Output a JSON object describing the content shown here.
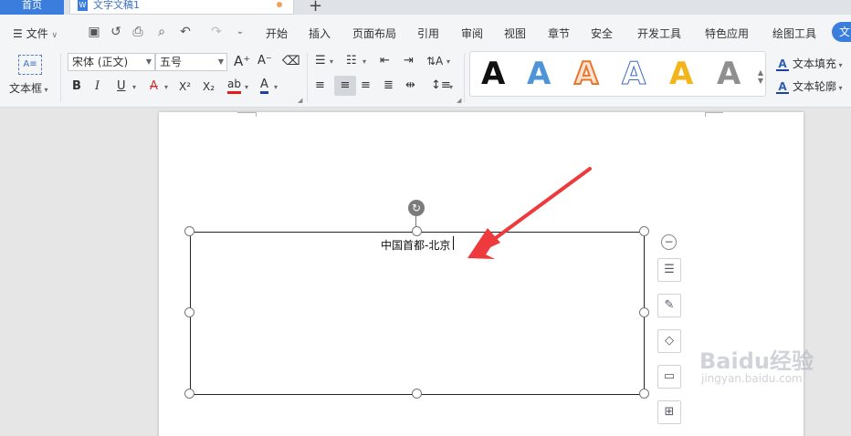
{
  "titlebar": {
    "home_tab": "首页",
    "doc_tab": "文字文稿1",
    "doc_icon": "W",
    "new_tab": "+"
  },
  "menubar": {
    "file_menu": "文件",
    "tabs": [
      "开始",
      "插入",
      "页面布局",
      "引用",
      "审阅",
      "视图",
      "章节",
      "安全",
      "开发工具",
      "特色应用",
      "绘图工具",
      "文"
    ]
  },
  "ribbon": {
    "textbox_label": "文本框",
    "font_name": "宋体 (正文)",
    "font_size": "五号",
    "bold": "B",
    "italic": "I",
    "underline": "U",
    "superscript": "X²",
    "subscript": "X₂",
    "highlight": "ab",
    "font_color": "A",
    "grow_font": "A⁺",
    "shrink_font": "A⁻",
    "text_fill": "文本填充",
    "text_outline": "文本轮廓",
    "styles": [
      "A",
      "A",
      "A",
      "A",
      "A",
      "A"
    ]
  },
  "document": {
    "textbox_text": "中国首都-北京"
  },
  "watermark": {
    "main": "Baidu经验",
    "sub": "jingyan.baidu.com"
  },
  "colors": {
    "accent": "#3b7ddd",
    "arrow": "#ee3a3c",
    "ribbon_bg": "#f4f5f7"
  }
}
